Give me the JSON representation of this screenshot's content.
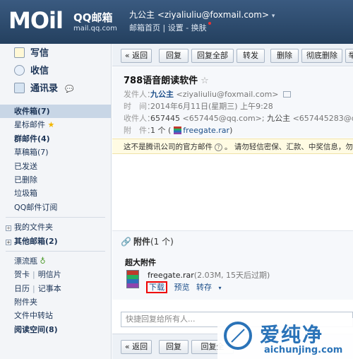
{
  "header": {
    "logo_text": "MOil",
    "logo_cn": "QQ邮箱",
    "logo_url": "mail.qq.com",
    "user": "九公主 <ziyaliuliu@foxmail.com>",
    "caret": "▾",
    "links": [
      "邮箱首页",
      "设置",
      "换肤"
    ],
    "sep": " | ",
    "sep2": " - "
  },
  "sidebar": {
    "quick": [
      {
        "label": "写信",
        "icon": "pencil-icon"
      },
      {
        "label": "收信",
        "icon": "inbox-icon"
      },
      {
        "label": "通讯录",
        "icon": "address-book-icon"
      }
    ],
    "folders": {
      "inbox": "收件箱(7)",
      "starred": "星标邮件",
      "groups": "群邮件(4)",
      "drafts": "草稿箱(7)",
      "sent": "已发送",
      "deleted": "已删除",
      "spam": "垃圾箱",
      "subscribe": "QQ邮件订阅",
      "my_folders": "我的文件夹",
      "other_mailbox": "其他邮箱(2)",
      "drift": "漂流瓶",
      "card": "贺卡",
      "postcard": "明信片",
      "calendar": "日历",
      "notes": "记事本",
      "attachments": "附件夹",
      "transfer": "文件中转站",
      "reading": "阅读空间(8)"
    },
    "expander": "+"
  },
  "toolbar": {
    "back": "« 返回",
    "reply": "回复",
    "reply_all": "回复全部",
    "forward": "转发",
    "delete": "删除",
    "delete_forever": "彻底删除",
    "more": "举"
  },
  "toolbar2": {
    "back": "« 返回",
    "reply": "回复",
    "reply_all": "回复全"
  },
  "mail": {
    "subject": "788语音朗读软件",
    "star": "☆",
    "from_label": "发件人：",
    "from_name": "九公主",
    "from_addr": " <ziyaliuliu@foxmail.com>",
    "time_label": "时　间：",
    "time": "2014年6月11日(星期三) 上午9:28",
    "to_label": "收件人：",
    "to_name1": "657445",
    "to_addr1": " <657445@qq.com>; ",
    "to_name2": "九公主",
    "to_addr2": " <657445283@qq.c",
    "att_label": "附　件：",
    "att_count": "1 个 (",
    "att_file": "freegate.rar",
    "att_close": ")"
  },
  "warning": {
    "text1": "这不是腾讯公司的官方邮件",
    "q": "?",
    "text2": "。 请勿轻信密保、汇款、中奖信息，勿轻"
  },
  "attachments": {
    "title": "附件",
    "count": "(1 个)",
    "super_title": "超大附件",
    "file_name": "freegate.rar",
    "file_info": "(2.03M, 15天后过期)",
    "download": "下载",
    "preview": "预览",
    "save": "转存",
    "save_caret": "▾"
  },
  "reply": {
    "placeholder": "快捷回复给所有人..."
  },
  "watermark": {
    "title": "爱纯净",
    "url": "aichunjing.com"
  }
}
